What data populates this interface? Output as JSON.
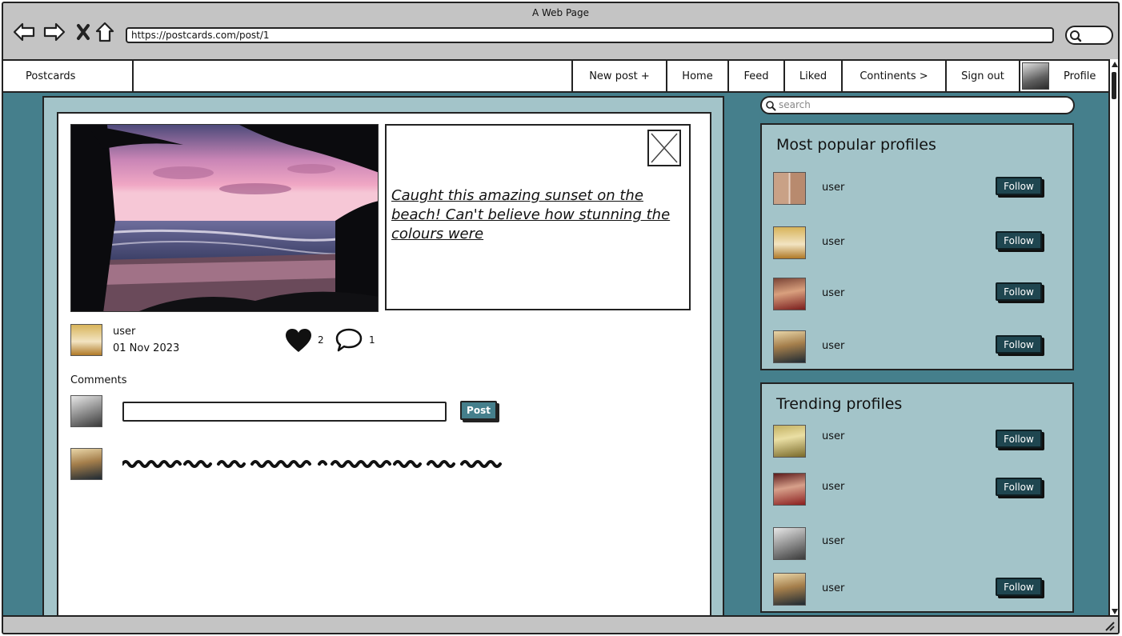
{
  "browser": {
    "window_title": "A Web Page",
    "url": "https://postcards.com/post/1"
  },
  "nav": {
    "brand": "Postcards",
    "items": [
      "New post +",
      "Home",
      "Feed",
      "Liked",
      "Continents >",
      "Sign out"
    ],
    "profile_label": "Profile"
  },
  "post": {
    "caption": "Caught this amazing sunset on the beach! Can't believe how stunning the colours were",
    "author": "user",
    "date": "01 Nov 2023",
    "likes": "2",
    "comments_count": "1"
  },
  "comments": {
    "heading": "Comments",
    "input_value": "",
    "post_button": "Post"
  },
  "sidebar": {
    "search_placeholder": "search",
    "popular": {
      "title": "Most popular profiles",
      "users": [
        {
          "name": "user",
          "button": "Follow"
        },
        {
          "name": "user",
          "button": "Follow"
        },
        {
          "name": "user",
          "button": "Follow"
        },
        {
          "name": "user",
          "button": "Follow"
        }
      ]
    },
    "trending": {
      "title": "Trending profiles",
      "users": [
        {
          "name": "user",
          "button": "Follow"
        },
        {
          "name": "user",
          "button": "Follow"
        },
        {
          "name": "user"
        },
        {
          "name": "user",
          "button": "Follow"
        }
      ]
    }
  },
  "colors": {
    "background_teal": "#457f8c",
    "panel_light": "#a3c4c9",
    "follow_button": "#1f4650"
  }
}
